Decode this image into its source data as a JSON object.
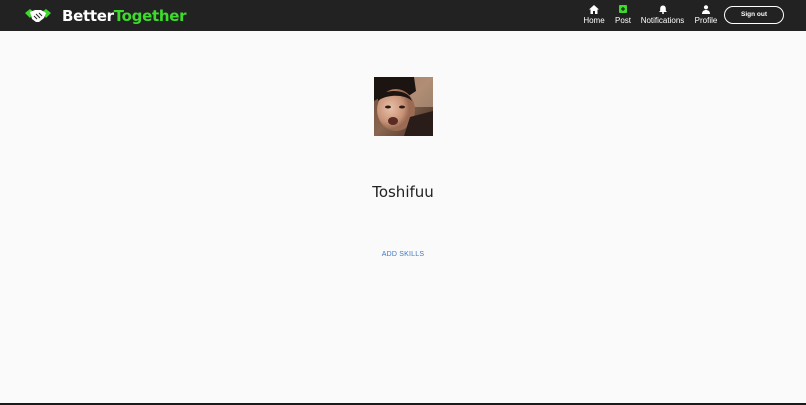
{
  "navbar": {
    "brand": {
      "part1": "Better",
      "part2": "Together",
      "logo_icon": "handshake-icon"
    },
    "items": [
      {
        "label": "Home",
        "icon": "home-icon"
      },
      {
        "label": "Post",
        "icon": "plus-square-icon"
      },
      {
        "label": "Notifications",
        "icon": "bell-icon"
      },
      {
        "label": "Profile",
        "icon": "user-icon"
      }
    ],
    "signout_label": "Sign out"
  },
  "profile": {
    "username": "Toshifuu",
    "add_skills_label": "ADD SKILLS",
    "avatar_alt": "profile-photo"
  },
  "colors": {
    "navbar_bg": "#222222",
    "brand_accent": "#3ddc2c",
    "link": "#3a78c9",
    "page_bg": "#fafafa"
  }
}
